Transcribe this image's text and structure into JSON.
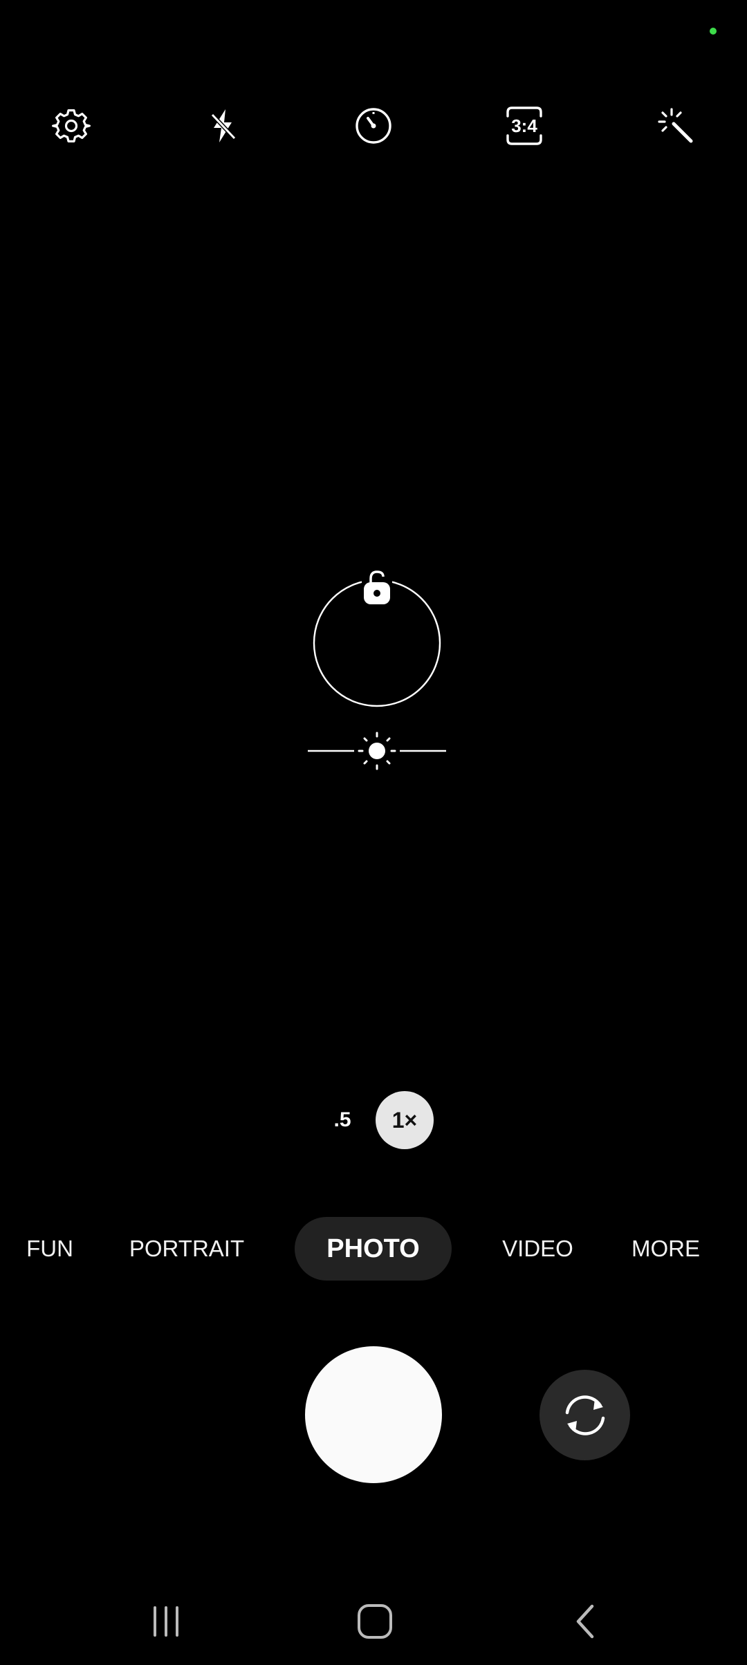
{
  "top_controls": {
    "aspect_ratio_label": "3:4"
  },
  "zoom": {
    "half_label": ".5",
    "one_label": "1×"
  },
  "modes": [
    "FUN",
    "PORTRAIT",
    "PHOTO",
    "VIDEO",
    "MORE"
  ],
  "active_mode": "PHOTO",
  "colors": {
    "background": "#000000",
    "status_dot": "#3ddc4a",
    "active_mode_pill": "#222222",
    "zoom_active": "#e6e6e6",
    "shutter": "#fafafa"
  }
}
